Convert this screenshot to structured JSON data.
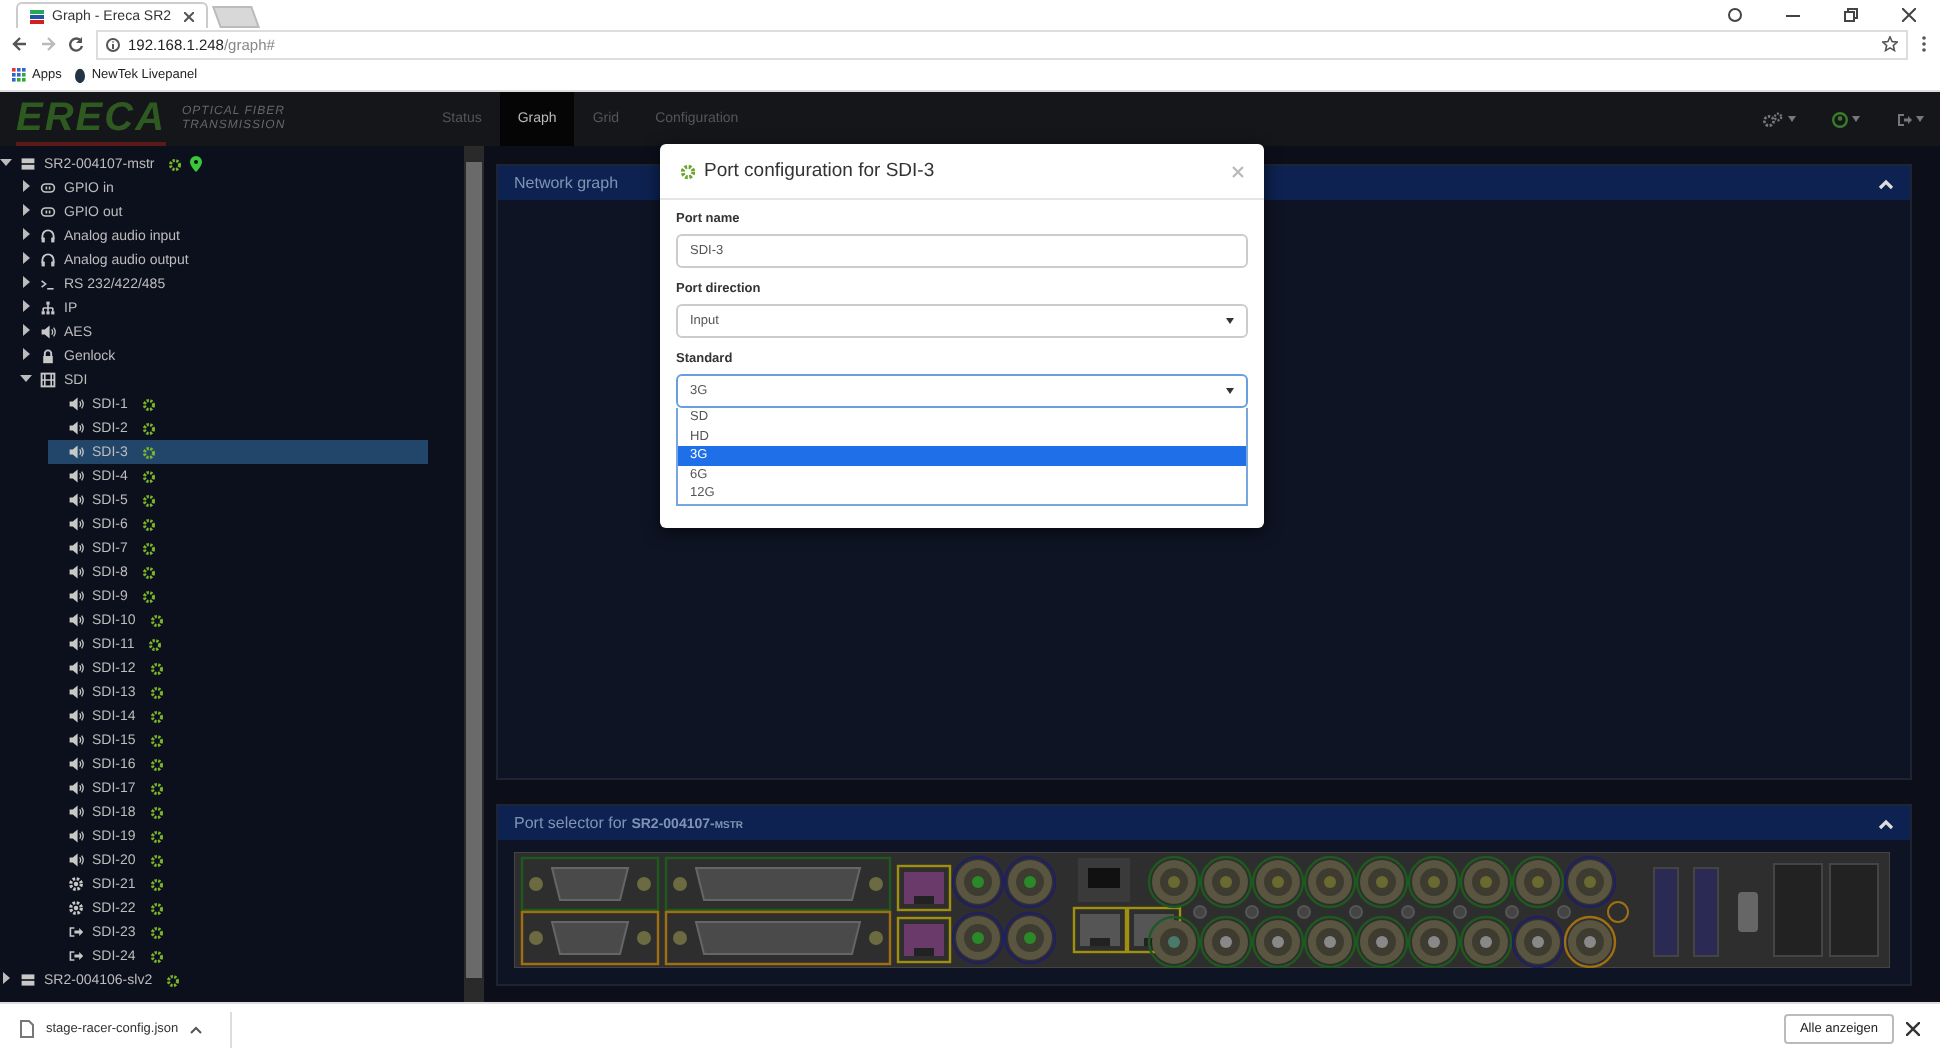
{
  "browser": {
    "tabs": [
      {
        "title": "Graph - Ereca SR2",
        "selected": true
      }
    ],
    "url": {
      "host": "192.168.1.248",
      "path": "/graph#"
    },
    "bookmarks": [
      "Apps",
      "NewTek Livepanel"
    ]
  },
  "header": {
    "logo": "ERECA",
    "tagline": [
      "OPTICAL FIBER",
      "TRANSMISSION"
    ],
    "nav": [
      {
        "label": "Status",
        "selected": false
      },
      {
        "label": "Graph",
        "selected": true
      },
      {
        "label": "Grid",
        "selected": false
      },
      {
        "label": "Configuration",
        "selected": false
      }
    ]
  },
  "tree": [
    {
      "label": "SR2-004107-mstr",
      "kind": "device",
      "expanded": true,
      "online": true,
      "located": true,
      "children": [
        {
          "label": "GPIO in",
          "kind": "gpio",
          "expanded": false
        },
        {
          "label": "GPIO out",
          "kind": "gpio",
          "expanded": false
        },
        {
          "label": "Analog audio input",
          "kind": "audio",
          "expanded": false
        },
        {
          "label": "Analog audio output",
          "kind": "audio",
          "expanded": false
        },
        {
          "label": "RS 232/422/485",
          "kind": "serial",
          "expanded": false
        },
        {
          "label": "IP",
          "kind": "network",
          "expanded": false
        },
        {
          "label": "AES",
          "kind": "speaker",
          "expanded": false
        },
        {
          "label": "Genlock",
          "kind": "lock",
          "expanded": false
        },
        {
          "label": "SDI",
          "kind": "film",
          "expanded": true,
          "children": [
            {
              "label": "SDI-1",
              "kind": "input",
              "online": true,
              "selected": false
            },
            {
              "label": "SDI-2",
              "kind": "input",
              "online": true,
              "selected": false
            },
            {
              "label": "SDI-3",
              "kind": "input",
              "online": true,
              "selected": true
            },
            {
              "label": "SDI-4",
              "kind": "input",
              "online": true,
              "selected": false
            },
            {
              "label": "SDI-5",
              "kind": "input",
              "online": true,
              "selected": false
            },
            {
              "label": "SDI-6",
              "kind": "input",
              "online": true,
              "selected": false
            },
            {
              "label": "SDI-7",
              "kind": "input",
              "online": true,
              "selected": false
            },
            {
              "label": "SDI-8",
              "kind": "input",
              "online": true,
              "selected": false
            },
            {
              "label": "SDI-9",
              "kind": "input",
              "online": true,
              "selected": false
            },
            {
              "label": "SDI-10",
              "kind": "input",
              "online": true,
              "selected": false
            },
            {
              "label": "SDI-11",
              "kind": "input",
              "online": true,
              "selected": false
            },
            {
              "label": "SDI-12",
              "kind": "input",
              "online": true,
              "selected": false
            },
            {
              "label": "SDI-13",
              "kind": "input",
              "online": true,
              "selected": false
            },
            {
              "label": "SDI-14",
              "kind": "input",
              "online": true,
              "selected": false
            },
            {
              "label": "SDI-15",
              "kind": "input",
              "online": true,
              "selected": false
            },
            {
              "label": "SDI-16",
              "kind": "input",
              "online": true,
              "selected": false
            },
            {
              "label": "SDI-17",
              "kind": "input",
              "online": true,
              "selected": false
            },
            {
              "label": "SDI-18",
              "kind": "input",
              "online": true,
              "selected": false
            },
            {
              "label": "SDI-19",
              "kind": "input",
              "online": true,
              "selected": false
            },
            {
              "label": "SDI-20",
              "kind": "input",
              "online": true,
              "selected": false
            },
            {
              "label": "SDI-21",
              "kind": "bidirectional",
              "online": true,
              "selected": false
            },
            {
              "label": "SDI-22",
              "kind": "bidirectional",
              "online": true,
              "selected": false
            },
            {
              "label": "SDI-23",
              "kind": "output",
              "online": true,
              "selected": false
            },
            {
              "label": "SDI-24",
              "kind": "output",
              "online": true,
              "selected": false
            }
          ]
        }
      ]
    },
    {
      "label": "SR2-004106-slv2",
      "kind": "device",
      "expanded": false,
      "online": true,
      "located": false
    }
  ],
  "panels": [
    {
      "title": "Network graph",
      "expanded": true
    },
    {
      "title": "Port selector for",
      "device": "SR2-004107-mstr",
      "expanded": true
    }
  ],
  "modal": {
    "title": "Port configuration for SDI-3",
    "fields": [
      {
        "label": "Port name",
        "kind": "text",
        "value": "SDI-3"
      },
      {
        "label": "Port direction",
        "kind": "select",
        "value": "Input",
        "open": false
      },
      {
        "label": "Standard",
        "kind": "select",
        "value": "3G",
        "open": true,
        "options": [
          {
            "label": "SD",
            "selected": false
          },
          {
            "label": "HD",
            "selected": false
          },
          {
            "label": "3G",
            "selected": true
          },
          {
            "label": "6G",
            "selected": false
          },
          {
            "label": "12G",
            "selected": false
          }
        ]
      }
    ]
  },
  "download": {
    "file": "stage-racer-config.json",
    "button": "Alle anzeigen"
  }
}
